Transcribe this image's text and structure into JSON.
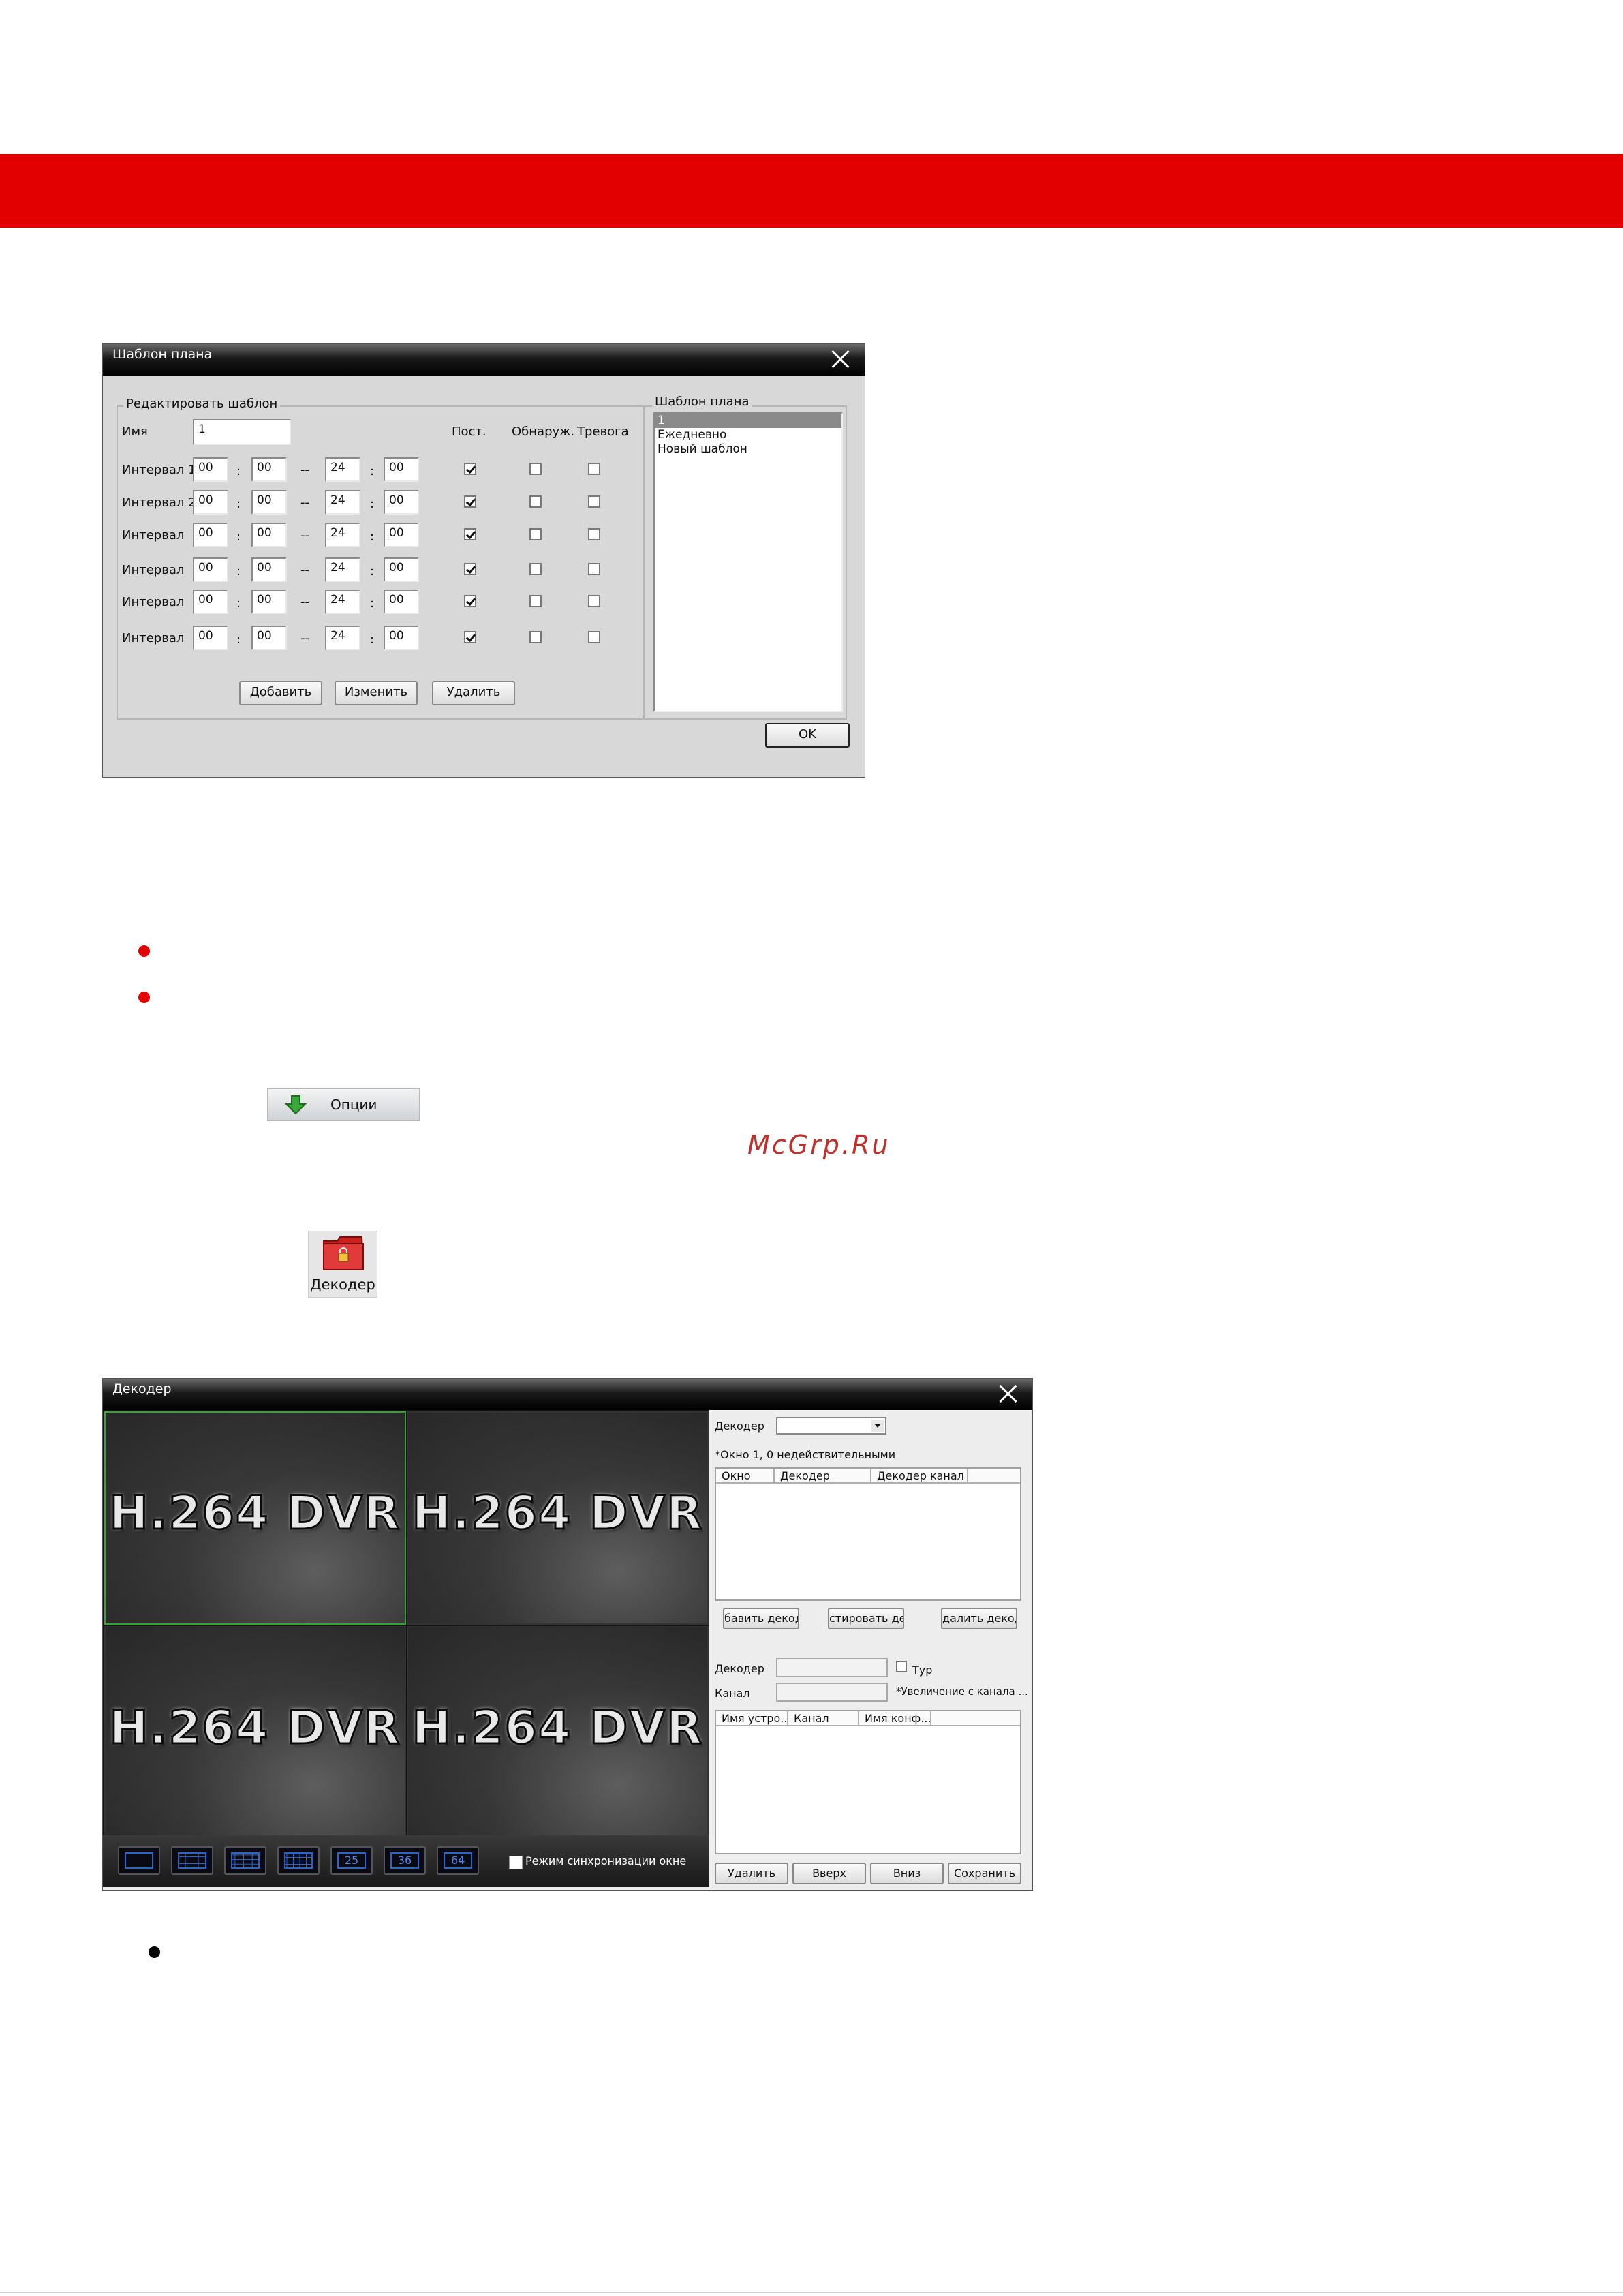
{
  "colors": {
    "band": "#e30000",
    "bullet_red": "#e30000",
    "watermark": "#c0302b"
  },
  "schedule_window": {
    "title": "Шаблон плана",
    "edit_group_label": "Редактировать шаблон",
    "name_label": "Имя",
    "name_value": "1",
    "col_headers": [
      "Пост.",
      "Обнаруж.",
      "Тревога"
    ],
    "rows": [
      {
        "label": "Интервал 1",
        "start_h": "00",
        "start_m": "00",
        "end_h": "24",
        "end_m": "00",
        "post": true,
        "detect": false,
        "alarm": false
      },
      {
        "label": "Интервал 2",
        "start_h": "00",
        "start_m": "00",
        "end_h": "24",
        "end_m": "00",
        "post": true,
        "detect": false,
        "alarm": false
      },
      {
        "label": "Интервал",
        "start_h": "00",
        "start_m": "00",
        "end_h": "24",
        "end_m": "00",
        "post": true,
        "detect": false,
        "alarm": false
      },
      {
        "label": "Интервал",
        "start_h": "00",
        "start_m": "00",
        "end_h": "24",
        "end_m": "00",
        "post": true,
        "detect": false,
        "alarm": false
      },
      {
        "label": "Интервал",
        "start_h": "00",
        "start_m": "00",
        "end_h": "24",
        "end_m": "00",
        "post": true,
        "detect": false,
        "alarm": false
      },
      {
        "label": "Интервал",
        "start_h": "00",
        "start_m": "00",
        "end_h": "24",
        "end_m": "00",
        "post": true,
        "detect": false,
        "alarm": false
      }
    ],
    "sep_colon": ":",
    "sep_dash": "--",
    "buttons": {
      "add": "Добавить",
      "edit": "Изменить",
      "delete": "Удалить",
      "ok": "OK"
    },
    "templates_group_label": "Шаблон плана",
    "templates": [
      "1",
      "Ежедневно",
      "Новый шаблон"
    ],
    "selected_template": 0
  },
  "options_button": {
    "label": "Опции",
    "icon": "green-down-arrow-icon"
  },
  "watermark": "McGrp.Ru",
  "decoder_icon": {
    "label": "Декодер",
    "icon": "red-folder-lock-icon"
  },
  "decoder_window": {
    "title": "Декодер",
    "tile_label": "H.264 DVR",
    "layout_buttons": [
      {
        "name": "layout-1",
        "text": ""
      },
      {
        "name": "layout-4",
        "text": ""
      },
      {
        "name": "layout-9",
        "text": ""
      },
      {
        "name": "layout-16",
        "text": ""
      },
      {
        "name": "layout-25",
        "text": "25"
      },
      {
        "name": "layout-36",
        "text": "36"
      },
      {
        "name": "layout-64",
        "text": "64"
      }
    ],
    "sync_label": "Режим синхронизации окне",
    "decoder_label": "Декодер",
    "note": "*Окно 1, 0 недействительными",
    "table1_headers": [
      "Окно",
      "Декодер",
      "Декодер канал"
    ],
    "mid_buttons": [
      "бавить декод",
      "стировать ден",
      "далить декоде"
    ],
    "decoder2_label": "Декодер",
    "tour_label": "Тур",
    "channel_label": "Канал",
    "zoom_note": "*Увеличение с канала ...",
    "table2_headers": [
      "Имя устро...",
      "Канал",
      "Имя конф..."
    ],
    "bottom_buttons": [
      "Удалить",
      "Вверх",
      "Вниз",
      "Сохранить"
    ]
  }
}
